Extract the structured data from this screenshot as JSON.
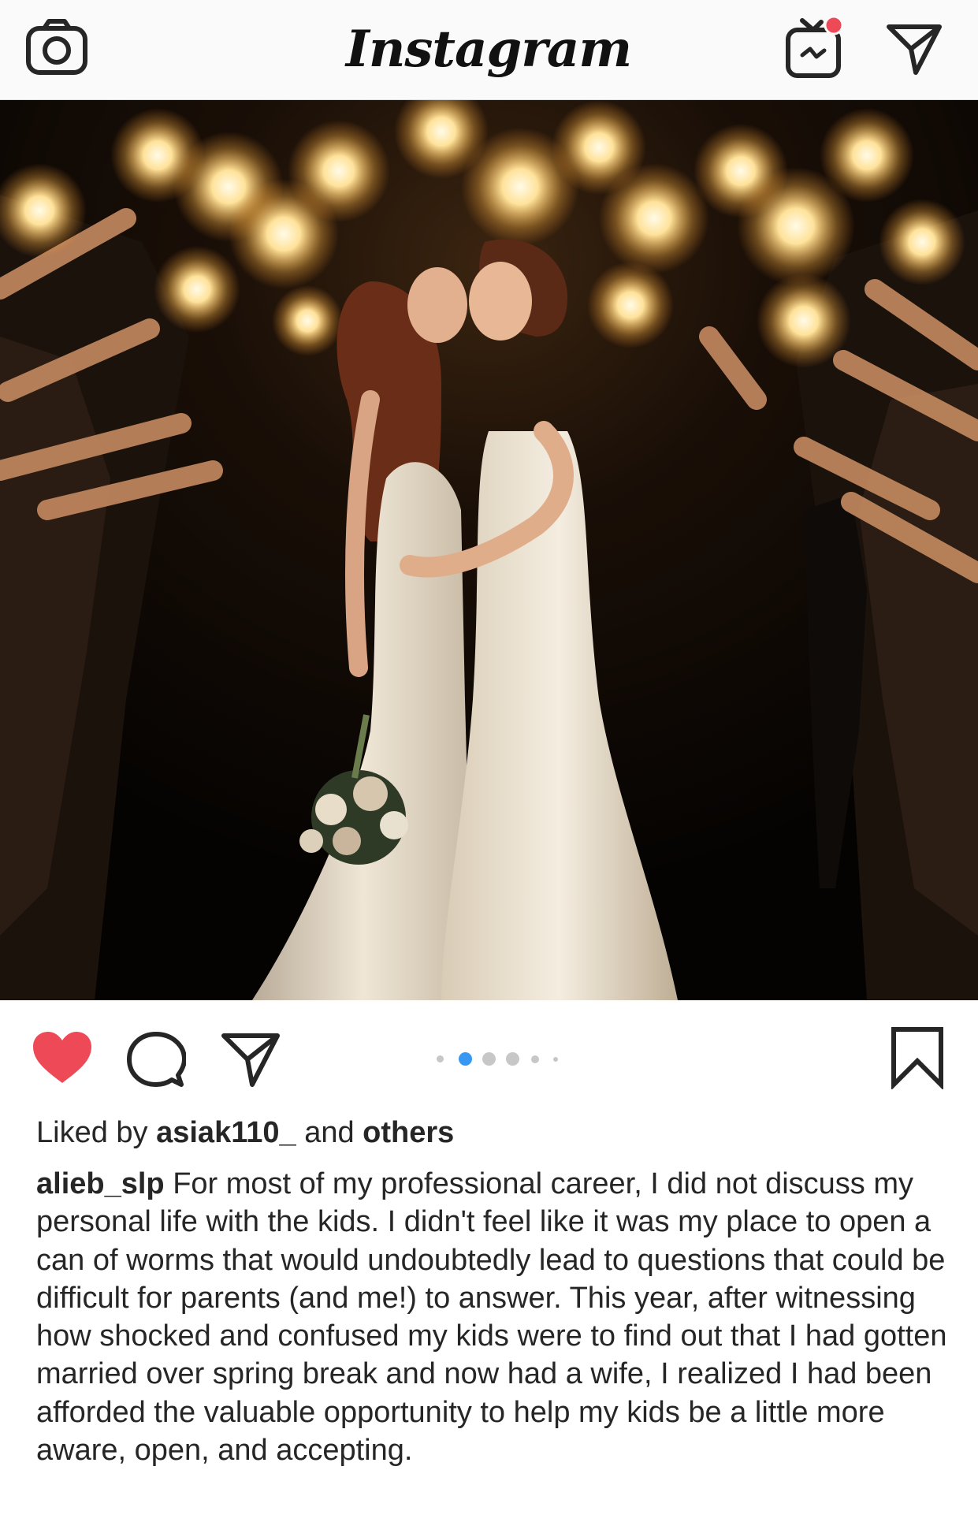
{
  "app": {
    "logo_text": "Instagram",
    "accent_color": "#ed4956"
  },
  "header": {
    "left_icon": "camera-icon",
    "right_icons": [
      "igtv-icon",
      "direct-message-icon"
    ]
  },
  "post": {
    "image_description_icon": "photo",
    "carousel": {
      "total": 6,
      "active_index": 1
    },
    "actions": {
      "liked": true,
      "icons": [
        "heart-icon",
        "comment-icon",
        "share-icon",
        "bookmark-icon"
      ]
    },
    "likes": {
      "prefix": "Liked by",
      "user": "asiak110_",
      "connector": "and",
      "others": "others"
    },
    "caption": {
      "username": "alieb_slp",
      "text": "For most of my professional career, I did not discuss my personal life with the kids. I didn't feel like it was my place to open a can of worms that would undoubtedly lead to questions that could be difficult for parents (and me!) to answer. This year, after witnessing how shocked and confused my kids were to find out that I had gotten married over spring break and now had a wife, I realized I had been afforded the valuable opportunity to help my kids be a little more aware, open, and accepting."
    }
  }
}
